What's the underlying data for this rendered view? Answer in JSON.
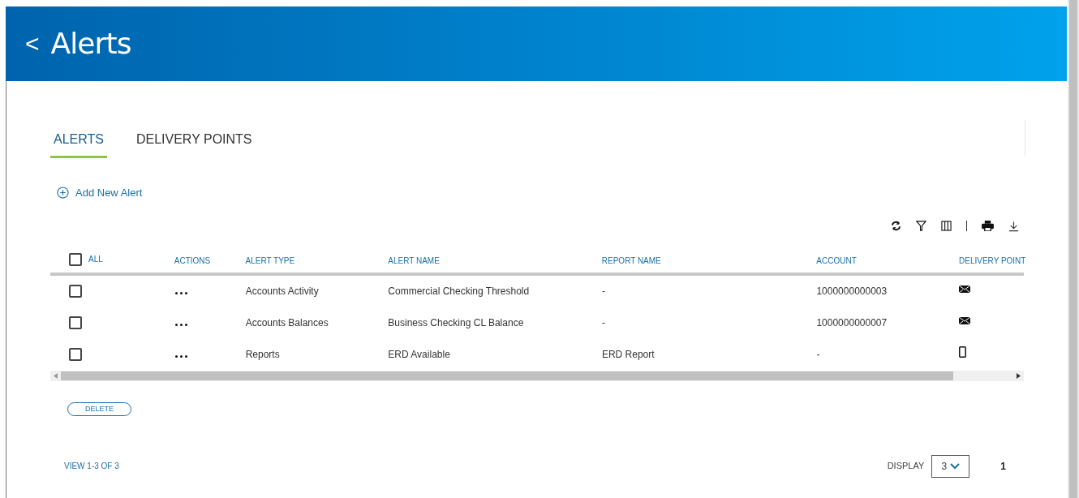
{
  "header": {
    "title": "Alerts",
    "back": "<"
  },
  "tabs": [
    {
      "label": "ALERTS",
      "selected": true
    },
    {
      "label": "DELIVERY POINTS",
      "selected": false
    }
  ],
  "add_button": "Add New Alert",
  "table": {
    "select_all": {
      "label": "ALL",
      "checked": false
    },
    "columns": [
      "ACTIONS",
      "ALERT TYPE",
      "ALERT NAME",
      "REPORT NAME",
      "ACCOUNT",
      "DELIVERY POINT"
    ],
    "rows": [
      {
        "checked": false,
        "alert_type": "Accounts Activity",
        "alert_name": "Commercial Checking Threshold",
        "report_name": "-",
        "account": "1000000000003",
        "kind": "email"
      },
      {
        "checked": false,
        "alert_type": "Accounts Balances",
        "alert_name": "Business Checking CL Balance",
        "report_name": "-",
        "account": "1000000000007",
        "kind": "email"
      },
      {
        "checked": false,
        "alert_type": "Reports",
        "alert_name": "ERD Available",
        "report_name": "ERD Report",
        "account": "-",
        "kind": "phone"
      }
    ]
  },
  "delete_button": "DELETE",
  "footer": {
    "view": "VIEW 1-3 OF 3",
    "display_label": "DISPLAY",
    "display_value": "3",
    "page": "1"
  }
}
